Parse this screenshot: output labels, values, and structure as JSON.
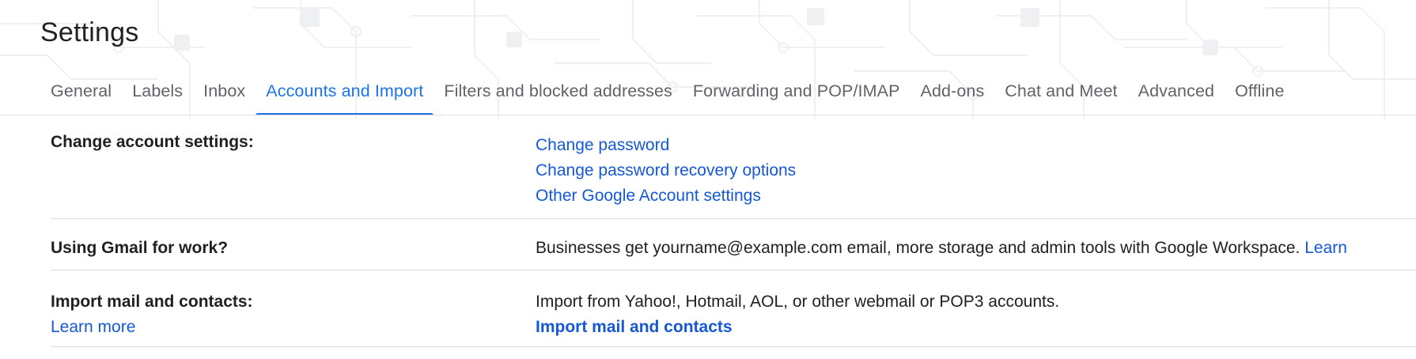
{
  "header": {
    "title": "Settings"
  },
  "tabs": [
    {
      "label": "General",
      "active": false
    },
    {
      "label": "Labels",
      "active": false
    },
    {
      "label": "Inbox",
      "active": false
    },
    {
      "label": "Accounts and Import",
      "active": true
    },
    {
      "label": "Filters and blocked addresses",
      "active": false
    },
    {
      "label": "Forwarding and POP/IMAP",
      "active": false
    },
    {
      "label": "Add-ons",
      "active": false
    },
    {
      "label": "Chat and Meet",
      "active": false
    },
    {
      "label": "Advanced",
      "active": false
    },
    {
      "label": "Offline",
      "active": false
    }
  ],
  "sections": {
    "change_account": {
      "label": "Change account settings:",
      "links": [
        "Change password",
        "Change password recovery options",
        "Other Google Account settings"
      ]
    },
    "gmail_for_work": {
      "label": "Using Gmail for work?",
      "text": "Businesses get yourname@example.com email, more storage and admin tools with Google Workspace.",
      "link": "Learn"
    },
    "import": {
      "label": "Import mail and contacts:",
      "learn_more": "Learn more",
      "text": "Import from Yahoo!, Hotmail, AOL, or other webmail or POP3 accounts.",
      "action": "Import mail and contacts"
    }
  },
  "colors": {
    "accent": "#1a73e8",
    "link": "#1558d6",
    "text": "#202124",
    "tab_text": "#5f6368",
    "divider": "#dadce0"
  }
}
